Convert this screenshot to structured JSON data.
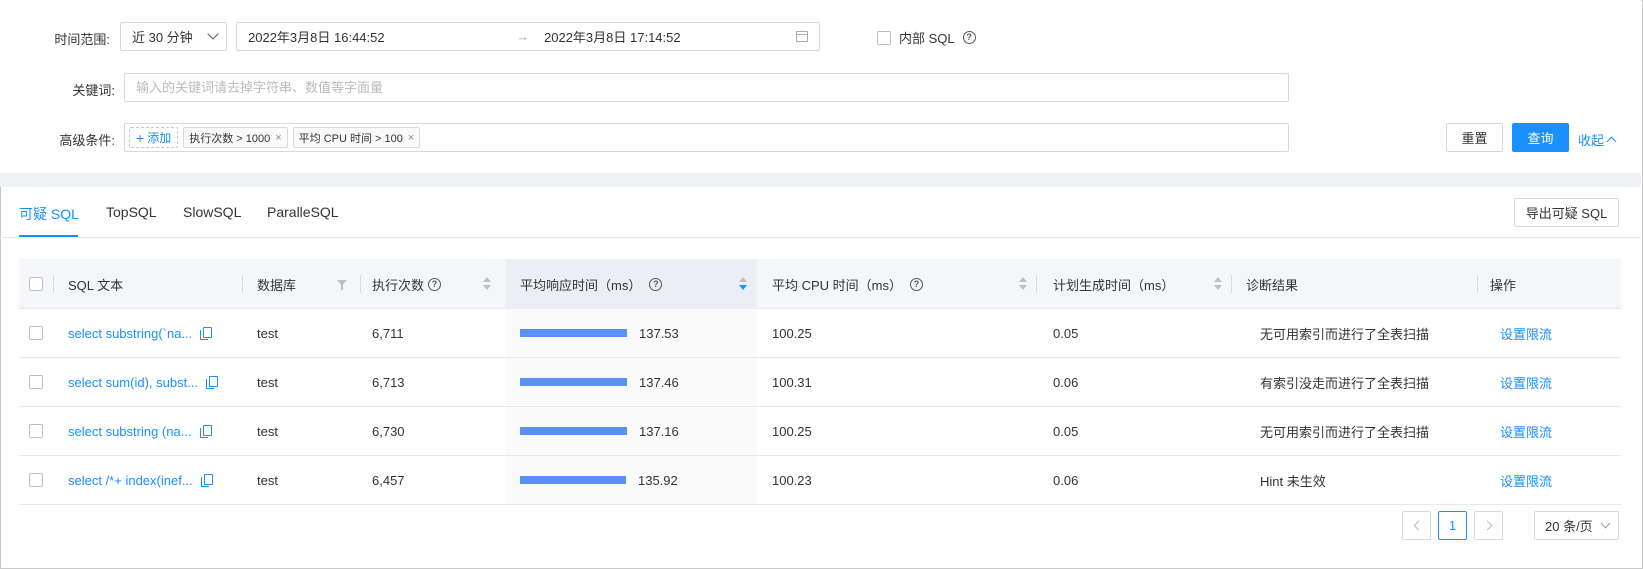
{
  "filters": {
    "time_range_label": "时间范围:",
    "time_range_value": "近 30 分钟",
    "start_date": "2022年3月8日 16:44:52",
    "end_date": "2022年3月8日 17:14:52",
    "arrow": "→",
    "internal_sql_label": "内部 SQL",
    "keyword_label": "关键词:",
    "keyword_placeholder": "输入的关键词请去掉字符串、数值等字面量",
    "advanced_label": "高级条件:",
    "add_label": "添加",
    "tags": [
      "执行次数 > 1000",
      "平均 CPU 时间 > 100"
    ],
    "reset_label": "重置",
    "query_label": "查询",
    "collapse_label": "收起"
  },
  "tabs": [
    "可疑 SQL",
    "TopSQL",
    "SlowSQL",
    "ParalleSQL"
  ],
  "export_label": "导出可疑 SQL",
  "table": {
    "headers": {
      "sql_text": "SQL 文本",
      "database": "数据库",
      "exec_count": "执行次数",
      "avg_response": "平均响应时间（ms）",
      "avg_cpu": "平均 CPU 时间（ms）",
      "plan_gen": "计划生成时间（ms）",
      "diagnosis": "诊断结果",
      "action": "操作"
    },
    "max_response": 137.53,
    "rows": [
      {
        "sql": "select substring(`na...",
        "db": "test",
        "count": "6,711",
        "resp": 137.53,
        "resp_text": "137.53",
        "cpu": "100.25",
        "plan": "0.05",
        "diag": "无可用索引而进行了全表扫描",
        "action": "设置限流"
      },
      {
        "sql": "select sum(id), subst...",
        "db": "test",
        "count": "6,713",
        "resp": 137.46,
        "resp_text": "137.46",
        "cpu": "100.31",
        "plan": "0.06",
        "diag": "有索引没走而进行了全表扫描",
        "action": "设置限流"
      },
      {
        "sql": "select substring (na...",
        "db": "test",
        "count": "6,730",
        "resp": 137.16,
        "resp_text": "137.16",
        "cpu": "100.25",
        "plan": "0.05",
        "diag": "无可用索引而进行了全表扫描",
        "action": "设置限流"
      },
      {
        "sql": "select /*+ index(inef...",
        "db": "test",
        "count": "6,457",
        "resp": 135.92,
        "resp_text": "135.92",
        "cpu": "100.23",
        "plan": "0.06",
        "diag": "Hint 未生效",
        "action": "设置限流"
      }
    ]
  },
  "pagination": {
    "current_page": "1",
    "page_size": "20 条/页"
  },
  "colors": {
    "accent": "#1890ff",
    "bar": "#5b8ff9"
  }
}
